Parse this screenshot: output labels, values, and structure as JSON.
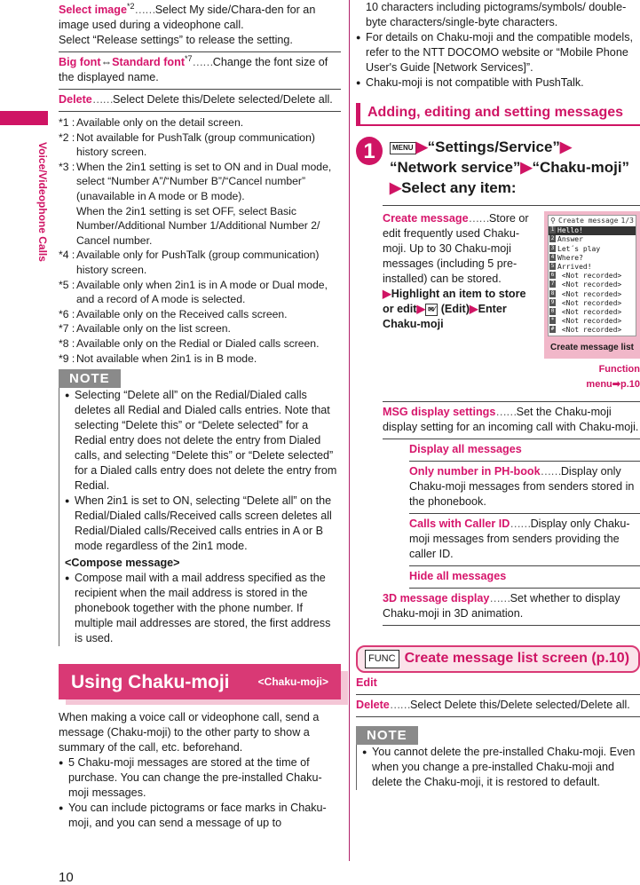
{
  "side": {
    "label": "Voice/Videophone Calls"
  },
  "left": {
    "items": [
      {
        "term": "Select image",
        "sup": "*2",
        "desc": "Select My side/Chara-den for an image used during a videophone call.",
        "extra": "Select “Release settings” to release the setting."
      },
      {
        "term": "Big font",
        "term_sep": "⇔",
        "term2": "Standard font",
        "sup": "*7",
        "desc": "Change the font size of the displayed name."
      },
      {
        "term": "Delete",
        "desc": "Select Delete this/Delete selected/Delete all."
      }
    ],
    "footnotes": [
      {
        "k": "*1 :",
        "v": "Available only on the detail screen."
      },
      {
        "k": "*2 :",
        "v": "Not available for PushTalk (group communication) history screen."
      },
      {
        "k": "*3 :",
        "v": "When the 2in1 setting is set to ON and in Dual mode, select “Number A”/“Number B”/“Cancel number” (unavailable in A mode or B mode).",
        "v2": "When the 2in1 setting is set OFF, select Basic Number/Additional Number 1/Additional Number 2/ Cancel number."
      },
      {
        "k": "*4 :",
        "v": "Available only for PushTalk (group communication) history screen."
      },
      {
        "k": "*5 :",
        "v": "Available only when 2in1 is in A mode or Dual mode, and a record of A mode is selected."
      },
      {
        "k": "*6 :",
        "v": "Available only on the Received calls screen."
      },
      {
        "k": "*7 :",
        "v": "Available only on the list screen."
      },
      {
        "k": "*8 :",
        "v": "Available only on the Redial or Dialed calls screen."
      },
      {
        "k": "*9 :",
        "v": "Not available when 2in1 is in B mode."
      }
    ],
    "note": {
      "tag": "NOTE",
      "bullets": [
        "Selecting “Delete all” on the Redial/Dialed calls deletes all Redial and Dialed calls entries. Note that selecting “Delete this” or “Delete selected” for a Redial entry does not delete the entry from Dialed calls, and selecting “Delete this” or “Delete selected” for a Dialed calls entry does not delete the entry from Redial.",
        "When 2in1 is set to ON, selecting “Delete all” on the Redial/Dialed calls/Received calls screen deletes all Redial/Dialed calls/Received calls entries in A or B mode regardless of the 2in1 mode."
      ],
      "compose_heading": "<Compose message>",
      "compose_bullet": "Compose mail with a mail address specified as the recipient when the mail address is stored in the phonebook together with the phone number. If multiple mail addresses are stored, the first address is used."
    },
    "section": {
      "title": "Using Chaku-moji",
      "sub": "<Chaku-moji>"
    },
    "intro": "When making a voice call or videophone call, send a message (Chaku-moji) to the other party to show a summary of the call, etc. beforehand.",
    "bullets": [
      "5 Chaku-moji messages are stored at the time of purchase. You can change the pre-installed Chaku-moji messages.",
      "You can include pictograms or face marks in Chaku-moji, and you can send a message of up to"
    ]
  },
  "right": {
    "cont": "10 characters including pictograms/symbols/ double-byte characters/single-byte characters.",
    "bullets": [
      "For details on Chaku-moji and the compatible models, refer to the NTT DOCOMO website or “Mobile Phone User's Guide [Network Services]”.",
      "Chaku-moji is not compatible with PushTalk."
    ],
    "subhead": "Adding, editing and setting messages",
    "step": {
      "num": "1",
      "menu_key": "MENU",
      "arrow": "▶",
      "p1": "“Settings/Service”",
      "p2": "“Network service”",
      "p3": "“Chaku-moji”",
      "p4": "Select any item:"
    },
    "create": {
      "term": "Create message",
      "desc": "Store or edit frequently used Chaku-moji. Up to 30 Chaku-moji messages (including 5 pre-installed) can be stored.",
      "action1": "Highlight an item to store or edit",
      "mail_key": "✉⁄",
      "action2": "(Edit)",
      "action3": "Enter Chaku-moji"
    },
    "phone": {
      "title": "Create message",
      "page": "1/3",
      "rows": [
        {
          "n": "1",
          "t": "Hello!"
        },
        {
          "n": "2",
          "t": "Answer"
        },
        {
          "n": "3",
          "t": "Let´s play"
        },
        {
          "n": "4",
          "t": "Where?"
        },
        {
          "n": "5",
          "t": "Arrived!"
        },
        {
          "n": "6",
          "t": " <Not recorded>"
        },
        {
          "n": "7",
          "t": " <Not recorded>"
        },
        {
          "n": "8",
          "t": " <Not recorded>"
        },
        {
          "n": "9",
          "t": " <Not recorded>"
        },
        {
          "n": "0",
          "t": " <Not recorded>"
        },
        {
          "n": "*",
          "t": " <Not recorded>"
        },
        {
          "n": "#",
          "t": " <Not recorded>"
        }
      ],
      "caption": "Create message list"
    },
    "function_menu": "Function menu➡p.10",
    "msg_display": {
      "term": "MSG display settings",
      "desc": "Set the Chaku-moji display setting for an incoming call with Chaku-moji."
    },
    "msg_options": [
      {
        "term": "Display all messages",
        "desc": ""
      },
      {
        "term": "Only number in PH-book",
        "desc": "Display only Chaku-moji messages from senders stored in the phonebook."
      },
      {
        "term": "Calls with Caller ID",
        "desc": "Display only Chaku-moji messages from senders providing the caller ID."
      },
      {
        "term": "Hide all messages",
        "desc": ""
      }
    ],
    "display3d": {
      "term": "3D message display",
      "desc": "Set whether to display Chaku-moji in 3D animation."
    },
    "func": {
      "key": "FUNC",
      "title": "Create message list screen (p.10)"
    },
    "func_items": [
      {
        "term": "Edit",
        "desc": ""
      },
      {
        "term": "Delete",
        "desc": "Select Delete this/Delete selected/Delete all."
      }
    ],
    "note": {
      "tag": "NOTE",
      "bullet": "You cannot delete the pre-installed Chaku-moji. Even when you change a pre-installed Chaku-moji and delete the Chaku-moji, it is restored to default."
    }
  },
  "dots": "……",
  "bullet_glyph": "●",
  "page_number": "10"
}
